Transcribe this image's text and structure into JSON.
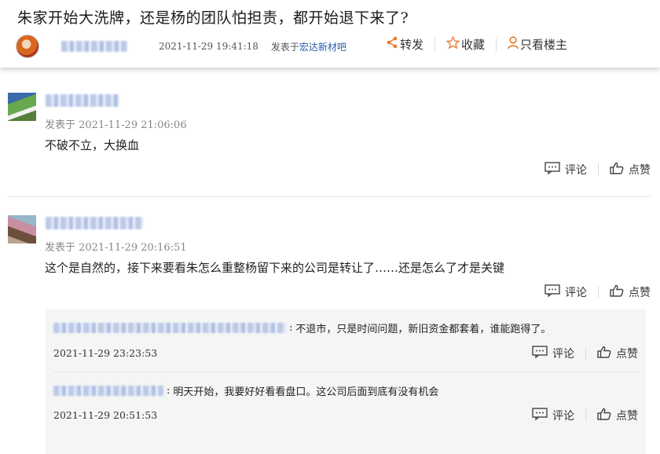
{
  "header": {
    "title": "朱家开始大洗牌，还是杨的团队怕担责，都开始退下来了?",
    "author": "(blurred)",
    "time": "2021-11-29 19:41:18",
    "posted_in_prefix": "发表于",
    "forum": "宏达新材吧",
    "actions": {
      "share": "转发",
      "favorite": "收藏",
      "only_op": "只看楼主"
    },
    "accent_color": "#e8792b"
  },
  "posts": [
    {
      "author": "(blurred)",
      "time": "发表于 2021-11-29 21:06:06",
      "text": "不破不立，大换血",
      "comment_label": "评论",
      "like_label": "点赞"
    },
    {
      "author": "(blurred)",
      "time": "发表于 2021-11-29 20:16:51",
      "text": "这个是自然的，接下来要看朱怎么重整杨留下来的公司是转让了……还是怎么了才是关键",
      "comment_label": "评论",
      "like_label": "点赞",
      "replies": [
        {
          "author": "(blurred)",
          "text": "不退市，只是时间问题，新旧资金都套着，谁能跑得了。",
          "time": "2021-11-29 23:23:53",
          "comment_label": "评论",
          "like_label": "点赞"
        },
        {
          "author": "(blurred)",
          "text": "明天开始，我要好好看看盘口。这公司后面到底有没有机会",
          "time": "2021-11-29 20:51:53",
          "comment_label": "评论",
          "like_label": "点赞"
        }
      ]
    }
  ]
}
